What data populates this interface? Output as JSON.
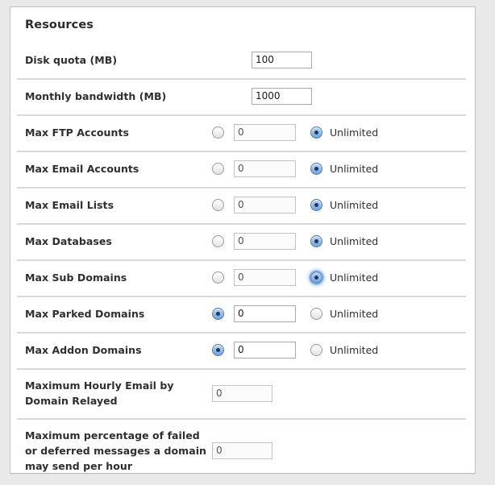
{
  "panel": {
    "title": "Resources"
  },
  "rows": [
    {
      "label": "Disk quota (MB)",
      "type": "text",
      "value": "100"
    },
    {
      "label": "Monthly bandwidth (MB)",
      "type": "text",
      "value": "1000"
    },
    {
      "label": "Max FTP Accounts",
      "type": "radio",
      "value": "0",
      "unlimited_label": "Unlimited",
      "selected": "unlimited",
      "focused": false
    },
    {
      "label": "Max Email Accounts",
      "type": "radio",
      "value": "0",
      "unlimited_label": "Unlimited",
      "selected": "unlimited",
      "focused": false
    },
    {
      "label": "Max Email Lists",
      "type": "radio",
      "value": "0",
      "unlimited_label": "Unlimited",
      "selected": "unlimited",
      "focused": false
    },
    {
      "label": "Max Databases",
      "type": "radio",
      "value": "0",
      "unlimited_label": "Unlimited",
      "selected": "unlimited",
      "focused": false
    },
    {
      "label": "Max Sub Domains",
      "type": "radio",
      "value": "0",
      "unlimited_label": "Unlimited",
      "selected": "unlimited",
      "focused": true
    },
    {
      "label": "Max Parked Domains",
      "type": "radio",
      "value": "0",
      "unlimited_label": "Unlimited",
      "selected": "value",
      "focused": false
    },
    {
      "label": "Max Addon Domains",
      "type": "radio",
      "value": "0",
      "unlimited_label": "Unlimited",
      "selected": "value",
      "focused": false
    },
    {
      "label": "Maximum Hourly Email by Domain Relayed",
      "type": "text",
      "value": "0"
    },
    {
      "label": "Maximum percentage of failed or deferred messages a domain may send per hour",
      "type": "text",
      "value": "0"
    }
  ],
  "colors": {
    "page_background": "#e9e9e9",
    "panel_background": "#ffffff",
    "panel_border": "#c2c2c2",
    "separator": "#d9d9d9",
    "label_text": "#2f2f2f",
    "radio_selected": "#6ea4dd",
    "radio_dot": "#1b3a63",
    "focus_ring": "#6ea4dd"
  }
}
